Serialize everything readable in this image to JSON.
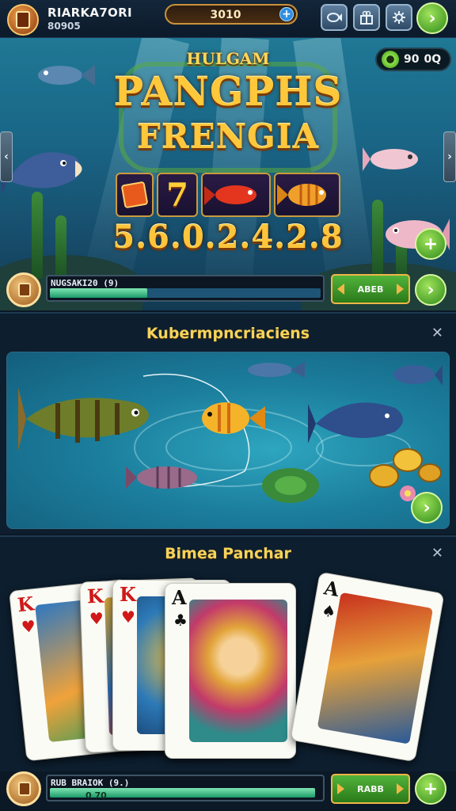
{
  "player": {
    "name": "RIARKA7ORI",
    "id": "80905"
  },
  "header": {
    "coins": "3010",
    "coin_plus": "+",
    "plus_pill_value": "90",
    "plus_pill_suffix": "0Q"
  },
  "toolbar": {
    "icons": [
      "fish-icon",
      "gift-icon",
      "settings-icon",
      "go-icon"
    ]
  },
  "hero": {
    "title_top": "HULGAM",
    "title_main": "PANGPHS",
    "title_sub": "FRENGIA",
    "reel_symbol": "7",
    "jackpot": "5.6.0.2.4.2.8",
    "left_arrow": "‹",
    "right_arrow": "›",
    "add_button": "+"
  },
  "bar1": {
    "label": "NUGSAKI20 (9)",
    "progress": 0.36,
    "button_label": "ABEB"
  },
  "section1": {
    "title": "Kubermpncriaciens",
    "close": "✕",
    "next": "›"
  },
  "section2": {
    "title": "Bimea Panchar",
    "close": "✕"
  },
  "cards": [
    {
      "rank": "K",
      "suit": "♥"
    },
    {
      "rank": "K",
      "suit": "♥"
    },
    {
      "rank": "K",
      "suit": "♥"
    },
    {
      "rank": "A",
      "suit": "♣"
    },
    {
      "rank": "A",
      "suit": "♠"
    }
  ],
  "bar2": {
    "label": "RUB BRAIOK (9.)",
    "sub": "0 70",
    "progress": 0.98,
    "button_label": "RABB",
    "add": "+"
  },
  "colors": {
    "gold": "#ffc73a",
    "green": "#3f9a1c",
    "panel": "#0d1e2e",
    "accent_blue": "#2f8fe0"
  }
}
